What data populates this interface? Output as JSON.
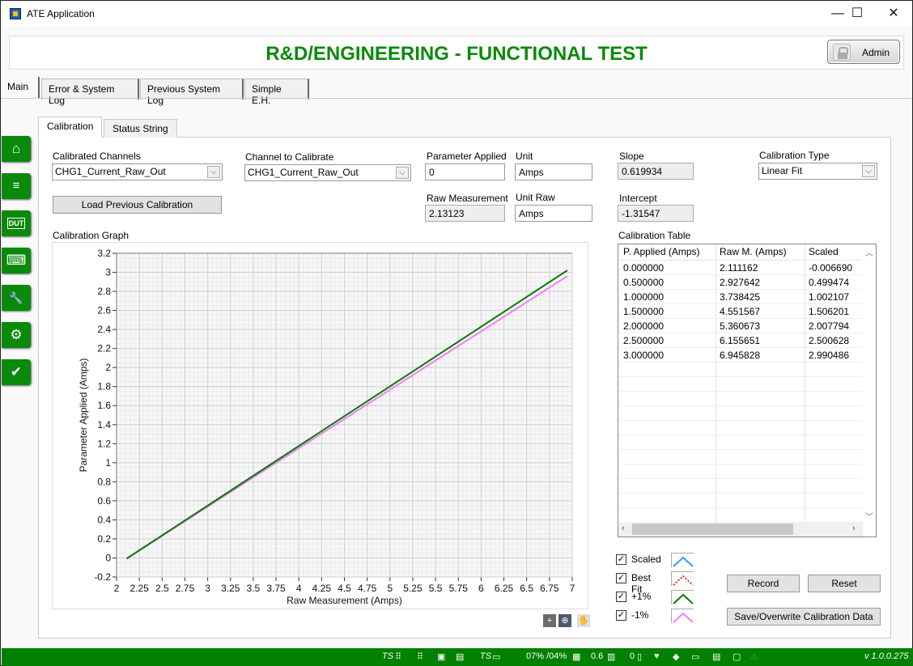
{
  "window": {
    "title": "ATE Application",
    "controls": {
      "minimize": "—",
      "maximize": "☐",
      "close": "✕"
    }
  },
  "banner": {
    "title": "R&D/ENGINEERING - FUNCTIONAL TEST",
    "admin_label": "Admin",
    "color": "#0a8a0a"
  },
  "main_tabs": [
    {
      "label": "Main",
      "active": true
    },
    {
      "label": "Error & System Log"
    },
    {
      "label": "Previous System Log"
    },
    {
      "label": "Simple E.H."
    }
  ],
  "sidebar": {
    "items": [
      {
        "icon": "home-icon",
        "glyph": "⌂"
      },
      {
        "icon": "list-waveform-icon",
        "glyph": "≡"
      },
      {
        "icon": "dut-icon",
        "glyph": "DUT"
      },
      {
        "icon": "keyboard-icon",
        "glyph": "⌨"
      },
      {
        "icon": "tools-icon",
        "glyph": "🔧"
      },
      {
        "icon": "monitor-settings-icon",
        "glyph": "⚙"
      },
      {
        "icon": "status-check-icon",
        "glyph": "✔"
      }
    ]
  },
  "sub_tabs": [
    {
      "label": "Calibration",
      "active": true
    },
    {
      "label": "Status String"
    }
  ],
  "calibration": {
    "calibrated_channels_label": "Calibrated Channels",
    "calibrated_channels_value": "CHG1_Current_Raw_Out",
    "channel_to_calibrate_label": "Channel to Calibrate",
    "channel_to_calibrate_value": "CHG1_Current_Raw_Out",
    "load_previous_label": "Load Previous Calibration",
    "parameter_applied_label": "Parameter Applied",
    "parameter_applied_value": "0",
    "unit_label": "Unit",
    "unit_value": "Amps",
    "raw_measurement_label": "Raw Measurement",
    "raw_measurement_value": "2.13123",
    "unit_raw_label": "Unit Raw",
    "unit_raw_value": "Amps",
    "slope_label": "Slope",
    "slope_value": "0.619934",
    "intercept_label": "Intercept",
    "intercept_value": "-1.31547",
    "calibration_type_label": "Calibration Type",
    "calibration_type_value": "Linear Fit",
    "graph_label": "Calibration Graph",
    "table_label": "Calibration Table"
  },
  "table": {
    "columns": [
      "P. Applied (Amps)",
      "Raw M. (Amps)",
      "Scaled"
    ],
    "rows": [
      [
        "0.000000",
        "2.111162",
        "-0.006690"
      ],
      [
        "0.500000",
        "2.927642",
        "0.499474"
      ],
      [
        "1.000000",
        "3.738425",
        "1.002107"
      ],
      [
        "1.500000",
        "4.551567",
        "1.506201"
      ],
      [
        "2.000000",
        "5.360673",
        "2.007794"
      ],
      [
        "2.500000",
        "6.155651",
        "2.500628"
      ],
      [
        "3.000000",
        "6.945828",
        "2.990486"
      ]
    ]
  },
  "legend": [
    {
      "label": "Scaled",
      "checked": true,
      "color": "#3a9af0",
      "style": "solid"
    },
    {
      "label": "Best Fit",
      "checked": true,
      "color": "#e03030",
      "style": "dotted"
    },
    {
      "label": "+1%",
      "checked": true,
      "color": "#0a7a0a",
      "style": "solid"
    },
    {
      "label": "-1%",
      "checked": true,
      "color": "#f080f0",
      "style": "solid"
    }
  ],
  "buttons": {
    "record": "Record",
    "reset": "Reset",
    "save": "Save/Overwrite Calibration Data"
  },
  "graph_tools": [
    "cursor-tool-icon",
    "zoom-tool-icon",
    "pan-hand-icon"
  ],
  "chart_data": {
    "type": "line",
    "title": "Calibration Graph",
    "xlabel": "Raw Measurement (Amps)",
    "ylabel": "Parameter Applied (Amps)",
    "xlim": [
      2,
      7
    ],
    "ylim": [
      -0.2,
      3.2
    ],
    "xticks": [
      "2",
      "2.25",
      "2.5",
      "2.75",
      "3",
      "3.25",
      "3.5",
      "3.75",
      "4",
      "4.25",
      "4.5",
      "4.75",
      "5",
      "5.25",
      "5.5",
      "5.75",
      "6",
      "6.25",
      "6.5",
      "6.75",
      "7"
    ],
    "yticks": [
      "-0.2",
      "0",
      "0.2",
      "0.4",
      "0.6",
      "0.8",
      "1",
      "1.2",
      "1.4",
      "1.6",
      "1.8",
      "2",
      "2.2",
      "2.4",
      "2.6",
      "2.8",
      "3",
      "3.2"
    ],
    "grid": true,
    "series": [
      {
        "name": "-1%",
        "color": "#f080f0",
        "x": [
          2.111162,
          6.945828
        ],
        "y": [
          -0.0066,
          2.9605
        ]
      },
      {
        "name": "+1%",
        "color": "#0a7a0a",
        "x": [
          2.111162,
          6.945828
        ],
        "y": [
          -0.0068,
          3.0205
        ]
      }
    ]
  },
  "statusbar": {
    "ts1": "TS",
    "ts2": "TS",
    "cpu_mem": "07% /04%",
    "value1": "0.6",
    "value2": "0",
    "version": "v 1.0.0.275"
  }
}
